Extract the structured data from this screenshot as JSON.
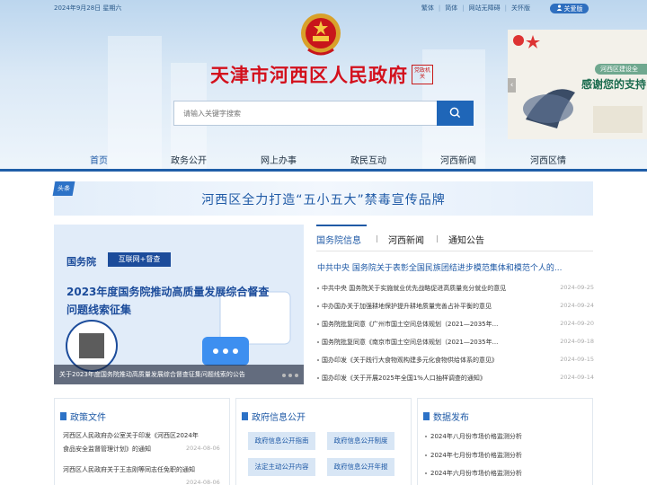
{
  "topbar": {
    "date": "2024年9月28日 星期六",
    "links": [
      "繁体",
      "简体",
      "网站无障碍",
      "关怀版"
    ],
    "care_button": "关爱版"
  },
  "site": {
    "title": "天津市河西区人民政府",
    "seal_text": "党政机关"
  },
  "search": {
    "placeholder": "请输入关键字搜索"
  },
  "banner_ad": {
    "badge": "河西区建设全",
    "text": "感谢您的支持"
  },
  "nav": {
    "items": [
      "首页",
      "政务公开",
      "网上办事",
      "政民互动",
      "河西新闻",
      "河西区情"
    ]
  },
  "headline": {
    "tag": "头条",
    "text": "河西区全力打造“五小五大”禁毒宣传品牌"
  },
  "slide": {
    "logo": "国务院",
    "tag": "互联网+督查",
    "line1": "2023年度国务院推动高质量发展综合督查",
    "line2": "问题线索征集",
    "caption": "关于2023年度国务院推动高质量发展综合督查征集问题线索的公告"
  },
  "news": {
    "tabs": [
      "国务院信息",
      "河西新闻",
      "通知公告"
    ],
    "featured": "中共中央 国务院关于表彰全国民族团结进步模范集体和模范个人的...",
    "items": [
      {
        "title": "中共中央 国务院关于实施就业优先战略促进高质量充分就业的意见",
        "date": "2024-09-25"
      },
      {
        "title": "中办国办关于加强耕地保护提升耕地质量完善占补平衡的意见",
        "date": "2024-09-24"
      },
      {
        "title": "国务院批复同意《广州市国土空间总体规划（2021—2035年...",
        "date": "2024-09-20"
      },
      {
        "title": "国务院批复同意《南京市国土空间总体规划（2021—2035年...",
        "date": "2024-09-18"
      },
      {
        "title": "国办印发《关于践行大食物观构建多元化食物供给体系的意见》",
        "date": "2024-09-15"
      },
      {
        "title": "国办印发《关于开展2025年全国1%人口抽样调查的通知》",
        "date": "2024-09-14"
      }
    ]
  },
  "panels": {
    "policy": {
      "title": "政策文件",
      "items": [
        {
          "line1": "河西区人民政府办公室关于印发《河西区2024年",
          "line2": "食品安全监督管理计划》的通知",
          "date": "2024-08-06"
        },
        {
          "line1": "河西区人民政府关于王志刚等同志任免职的通知",
          "line2": "",
          "date": "2024-08-06"
        }
      ]
    },
    "gov_info": {
      "title": "政府信息公开",
      "buttons": [
        "政府信息公开指南",
        "政府信息公开制度",
        "法定主动公开内容",
        "政府信息公开年报"
      ]
    },
    "data": {
      "title": "数据发布",
      "items": [
        "2024年八月份市场价格监测分析",
        "2024年七月份市场价格监测分析",
        "2024年六月份市场价格监测分析"
      ]
    }
  },
  "colors": {
    "brand_red": "#d3101c",
    "brand_blue": "#1f5aa6",
    "nav_bar": "#1f5ea8"
  }
}
